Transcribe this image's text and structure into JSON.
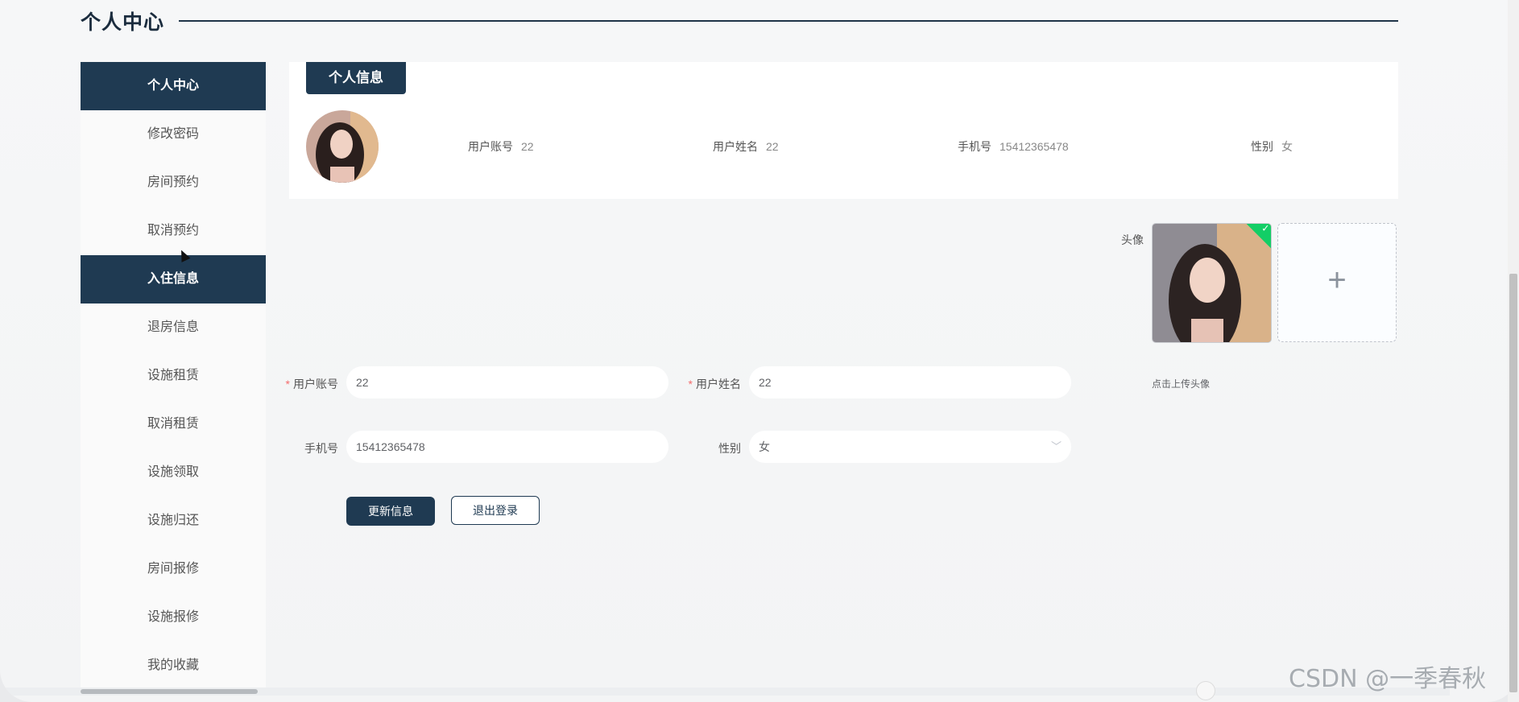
{
  "page": {
    "title": "个人中心"
  },
  "sidebar": {
    "items": [
      {
        "label": "个人中心",
        "active": true
      },
      {
        "label": "修改密码",
        "active": false
      },
      {
        "label": "房间预约",
        "active": false
      },
      {
        "label": "取消预约",
        "active": false
      },
      {
        "label": "入住信息",
        "active": true
      },
      {
        "label": "退房信息",
        "active": false
      },
      {
        "label": "设施租赁",
        "active": false
      },
      {
        "label": "取消租赁",
        "active": false
      },
      {
        "label": "设施领取",
        "active": false
      },
      {
        "label": "设施归还",
        "active": false
      },
      {
        "label": "房间报修",
        "active": false
      },
      {
        "label": "设施报修",
        "active": false
      },
      {
        "label": "我的收藏",
        "active": false
      }
    ]
  },
  "info": {
    "tab_label": "个人信息",
    "account_label": "用户账号",
    "account_value": "22",
    "name_label": "用户姓名",
    "name_value": "22",
    "phone_label": "手机号",
    "phone_value": "15412365478",
    "gender_label": "性别",
    "gender_value": "女"
  },
  "upload": {
    "label": "头像",
    "tip": "点击上传头像",
    "add_icon": "+"
  },
  "form": {
    "account_label": "用户账号",
    "account_value": "22",
    "name_label": "用户姓名",
    "name_value": "22",
    "phone_label": "手机号",
    "phone_value": "15412365478",
    "gender_label": "性别",
    "gender_value": "女",
    "required_mark": "*"
  },
  "buttons": {
    "update": "更新信息",
    "logout": "退出登录"
  },
  "watermark": "CSDN @一季春秋",
  "colors": {
    "primary": "#1f3a52",
    "success": "#13ce66",
    "required": "#f56c6c"
  },
  "icons": {
    "upload_check": "check-icon",
    "add": "plus-icon",
    "select_arrow": "chevron-down-icon"
  }
}
